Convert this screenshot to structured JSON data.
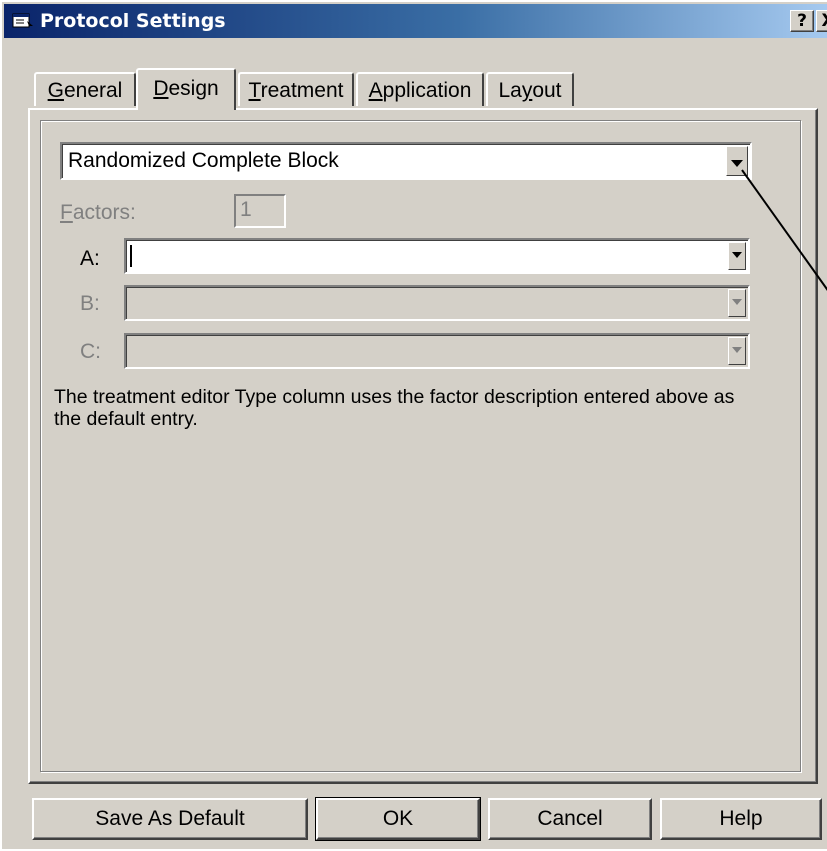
{
  "window": {
    "title": "Protocol Settings",
    "help_button": "?",
    "close_button": "X"
  },
  "tabs": [
    {
      "label": "General",
      "mnemonic": "G",
      "rest": "eneral",
      "active": false
    },
    {
      "label": "Design",
      "mnemonic": "D",
      "rest": "esign",
      "active": true
    },
    {
      "label": "Treatment",
      "mnemonic": "T",
      "rest": "reatment",
      "active": false
    },
    {
      "label": "Application",
      "mnemonic": "A",
      "rest": "pplication",
      "active": false
    },
    {
      "label": "Layout",
      "mnemonic": "y",
      "pre": "La",
      "rest": "out",
      "active": false
    }
  ],
  "design": {
    "selected_value": "Randomized Complete Block",
    "factors_label_mnemonic": "F",
    "factors_label_rest": "actors:",
    "factors_value": "1",
    "factor_a_label": "A:",
    "factor_a_value": "",
    "factor_b_label": "B:",
    "factor_b_value": "",
    "factor_c_label": "C:",
    "factor_c_value": "",
    "note": "The treatment editor Type column uses the factor description entered above as the default entry."
  },
  "buttons": {
    "save_default": "Save As Default",
    "ok": "OK",
    "cancel": "Cancel",
    "help": "Help"
  },
  "colors": {
    "face": "#d4d0c8",
    "title_start": "#0a246a",
    "title_end": "#a6caf0",
    "disabled_text": "#808080"
  },
  "icons": {
    "title": "protocol-window-icon",
    "dropdown": "chevron-down-icon"
  }
}
